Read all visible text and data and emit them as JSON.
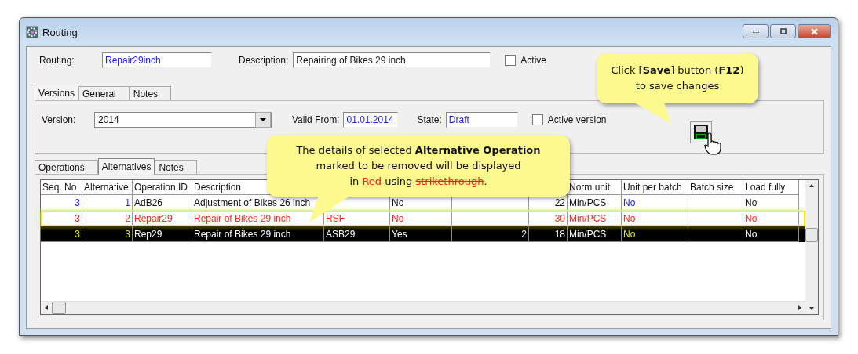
{
  "window": {
    "title": "Routing"
  },
  "routing": {
    "label": "Routing:",
    "value": "Repair29inch"
  },
  "description": {
    "label": "Description:",
    "value": "Repairing of Bikes 29 inch"
  },
  "active": {
    "label": "Active",
    "checked": false
  },
  "tabs": [
    {
      "label": "Versions",
      "selected": true
    },
    {
      "label": "General",
      "selected": false
    },
    {
      "label": "Notes",
      "selected": false
    }
  ],
  "version": {
    "label": "Version:",
    "value": "2014"
  },
  "valid_from": {
    "label": "Valid From:",
    "value": "01.01.2014"
  },
  "state": {
    "label": "State:",
    "value": "Draft"
  },
  "active_version": {
    "label": "Active version",
    "checked": false
  },
  "inner_tabs": [
    {
      "label": "Operations",
      "selected": false
    },
    {
      "label": "Alternatives",
      "selected": true
    },
    {
      "label": "Notes",
      "selected": false
    }
  ],
  "table": {
    "columns": [
      "Seq. No",
      "Alternative",
      "Operation ID",
      "Description",
      null,
      null,
      null,
      null,
      "Norm unit",
      "Unit per batch",
      "Batch size",
      "Load fully"
    ],
    "rows": [
      {
        "selected": false,
        "removed": false,
        "cells": [
          "3",
          "1",
          "AdB26",
          "Adjustment of Bikes 26 inch",
          null,
          "No",
          null,
          "22",
          "Min/PCS",
          "No",
          null,
          "No"
        ]
      },
      {
        "selected": false,
        "removed": true,
        "cells": [
          "3",
          "2",
          "Repair29",
          "Repair of Bikes 29 inch",
          "RSF",
          "No",
          null,
          "30",
          "Min/PCS",
          "No",
          null,
          "No"
        ]
      },
      {
        "selected": true,
        "removed": false,
        "cells": [
          "3",
          "3",
          "Rep29",
          "Repair of Bikes 29 inch",
          "ASB29",
          "Yes",
          "2",
          "18",
          "Min/PCS",
          "No",
          null,
          "No"
        ]
      }
    ]
  },
  "callouts": [
    {
      "lines": [
        [
          {
            "kind": "plain",
            "text": "Click ["
          },
          {
            "kind": "bold",
            "text": "Save"
          },
          {
            "kind": "plain",
            "text": "] button ("
          },
          {
            "kind": "bold",
            "text": "F12"
          },
          {
            "kind": "plain",
            "text": ")"
          }
        ],
        [
          {
            "kind": "plain",
            "text": "to save changes"
          }
        ]
      ]
    },
    {
      "lines": [
        [
          {
            "kind": "plain",
            "text": "The details of selected "
          },
          {
            "kind": "bold",
            "text": "Alternative Operation"
          }
        ],
        [
          {
            "kind": "plain",
            "text": "marked to be removed will be displayed"
          }
        ],
        [
          {
            "kind": "plain",
            "text": "in "
          },
          {
            "kind": "red",
            "text": "Red"
          },
          {
            "kind": "plain",
            "text": " using "
          },
          {
            "kind": "red-strike",
            "text": "strikethrough"
          },
          {
            "kind": "plain",
            "text": "."
          }
        ]
      ]
    }
  ]
}
